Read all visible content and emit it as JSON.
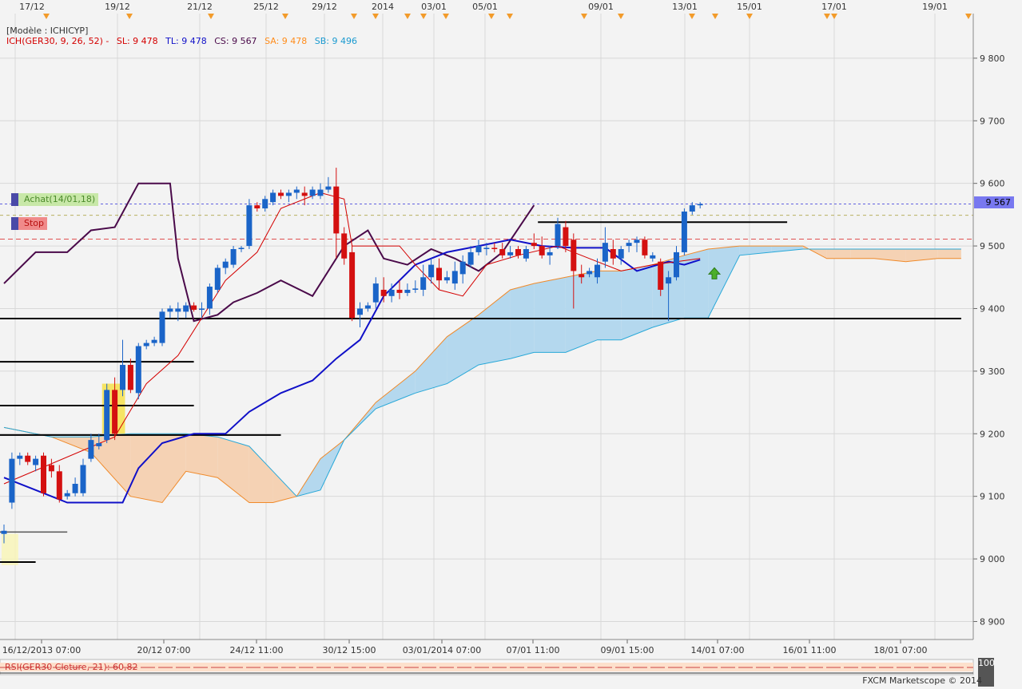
{
  "header": {
    "model": "[Modèle : ICHICYP]",
    "ich_params": "ICH(GER30, 9, 26, 52) -",
    "sl": "SL: 9 478",
    "tl": "TL: 9 478",
    "cs": "CS: 9 567",
    "sa": "SA: 9 478",
    "sb": "SB: 9 496"
  },
  "orders": {
    "buy_label": "Achat(14/01,18)",
    "stop_label": "Stop"
  },
  "price_tag": "9 567",
  "rsi_label": "RSI(GER30 Cloture, 21): 60,82",
  "rsi_scale_top": "100",
  "copyright": "FXCM Marketscope © 2014",
  "colors": {
    "bull": "#1a64c8",
    "bear": "#d41010",
    "tenkan": "#d40000",
    "kijun": "#1010c8",
    "chikou": "#4a0a4a",
    "cloud_bull": "#b4d8ee",
    "cloud_bear": "#f5d2b4",
    "grid": "#d8d8d8"
  },
  "chart_data": {
    "type": "candlestick",
    "title": "",
    "ylim": [
      8870,
      9870
    ],
    "y_ticks": [
      8900,
      9000,
      9100,
      9200,
      9300,
      9400,
      9500,
      9600,
      9700,
      9800
    ],
    "y_tick_labels": [
      "8 900",
      "9 000",
      "9 100",
      "9 200",
      "9 300",
      "9 400",
      "9 500",
      "9 600",
      "9 700",
      "9 800"
    ],
    "x_top_labels": [
      "17/12",
      "19/12",
      "21/12",
      "25/12",
      "29/12",
      "2014",
      "03/01",
      "05/01",
      "09/01",
      "13/01",
      "15/01",
      "17/01",
      "19/01"
    ],
    "x_bottom_labels": [
      "16/12/2013 07:00",
      "20/12 07:00",
      "24/12 11:00",
      "30/12 15:00",
      "03/01/2014 07:00",
      "07/01 11:00",
      "09/01 15:00",
      "14/01 07:00",
      "16/01 11:00",
      "18/01 07:00"
    ],
    "candles": [
      {
        "o": 9040,
        "h": 9055,
        "l": 9025,
        "c": 9045
      },
      {
        "o": 9090,
        "h": 9170,
        "l": 9080,
        "c": 9160
      },
      {
        "o": 9160,
        "h": 9170,
        "l": 9150,
        "c": 9165
      },
      {
        "o": 9165,
        "h": 9170,
        "l": 9150,
        "c": 9155
      },
      {
        "o": 9150,
        "h": 9165,
        "l": 9140,
        "c": 9160
      },
      {
        "o": 9165,
        "h": 9170,
        "l": 9100,
        "c": 9105
      },
      {
        "o": 9150,
        "h": 9160,
        "l": 9130,
        "c": 9140
      },
      {
        "o": 9140,
        "h": 9150,
        "l": 9090,
        "c": 9095
      },
      {
        "o": 9100,
        "h": 9110,
        "l": 9095,
        "c": 9105
      },
      {
        "o": 9105,
        "h": 9130,
        "l": 9100,
        "c": 9120
      },
      {
        "o": 9105,
        "h": 9160,
        "l": 9100,
        "c": 9150
      },
      {
        "o": 9160,
        "h": 9200,
        "l": 9155,
        "c": 9190
      },
      {
        "o": 9180,
        "h": 9200,
        "l": 9175,
        "c": 9185
      },
      {
        "o": 9190,
        "h": 9280,
        "l": 9185,
        "c": 9270
      },
      {
        "o": 9270,
        "h": 9290,
        "l": 9190,
        "c": 9200
      },
      {
        "o": 9270,
        "h": 9350,
        "l": 9260,
        "c": 9310
      },
      {
        "o": 9310,
        "h": 9320,
        "l": 9265,
        "c": 9270
      },
      {
        "o": 9265,
        "h": 9345,
        "l": 9255,
        "c": 9340
      },
      {
        "o": 9340,
        "h": 9350,
        "l": 9335,
        "c": 9345
      },
      {
        "o": 9345,
        "h": 9355,
        "l": 9340,
        "c": 9350
      },
      {
        "o": 9345,
        "h": 9400,
        "l": 9340,
        "c": 9395
      },
      {
        "o": 9395,
        "h": 9405,
        "l": 9385,
        "c": 9400
      },
      {
        "o": 9395,
        "h": 9410,
        "l": 9380,
        "c": 9400
      },
      {
        "o": 9395,
        "h": 9410,
        "l": 9385,
        "c": 9405
      },
      {
        "o": 9405,
        "h": 9410,
        "l": 9395,
        "c": 9398
      },
      {
        "o": 9398,
        "h": 9410,
        "l": 9385,
        "c": 9400
      },
      {
        "o": 9400,
        "h": 9440,
        "l": 9390,
        "c": 9435
      },
      {
        "o": 9430,
        "h": 9470,
        "l": 9425,
        "c": 9465
      },
      {
        "o": 9465,
        "h": 9480,
        "l": 9455,
        "c": 9475
      },
      {
        "o": 9470,
        "h": 9500,
        "l": 9465,
        "c": 9495
      },
      {
        "o": 9495,
        "h": 9500,
        "l": 9490,
        "c": 9497
      },
      {
        "o": 9500,
        "h": 9575,
        "l": 9495,
        "c": 9565
      },
      {
        "o": 9565,
        "h": 9570,
        "l": 9555,
        "c": 9560
      },
      {
        "o": 9560,
        "h": 9580,
        "l": 9555,
        "c": 9575
      },
      {
        "o": 9570,
        "h": 9590,
        "l": 9565,
        "c": 9585
      },
      {
        "o": 9585,
        "h": 9590,
        "l": 9575,
        "c": 9580
      },
      {
        "o": 9580,
        "h": 9590,
        "l": 9570,
        "c": 9585
      },
      {
        "o": 9585,
        "h": 9595,
        "l": 9575,
        "c": 9590
      },
      {
        "o": 9585,
        "h": 9595,
        "l": 9565,
        "c": 9580
      },
      {
        "o": 9580,
        "h": 9595,
        "l": 9575,
        "c": 9590
      },
      {
        "o": 9580,
        "h": 9600,
        "l": 9575,
        "c": 9590
      },
      {
        "o": 9590,
        "h": 9610,
        "l": 9585,
        "c": 9595
      },
      {
        "o": 9595,
        "h": 9625,
        "l": 9480,
        "c": 9520
      },
      {
        "o": 9520,
        "h": 9530,
        "l": 9470,
        "c": 9480
      },
      {
        "o": 9490,
        "h": 9500,
        "l": 9380,
        "c": 9385
      },
      {
        "o": 9390,
        "h": 9410,
        "l": 9370,
        "c": 9400
      },
      {
        "o": 9400,
        "h": 9410,
        "l": 9395,
        "c": 9405
      },
      {
        "o": 9410,
        "h": 9450,
        "l": 9400,
        "c": 9440
      },
      {
        "o": 9430,
        "h": 9450,
        "l": 9410,
        "c": 9420
      },
      {
        "o": 9420,
        "h": 9440,
        "l": 9410,
        "c": 9430
      },
      {
        "o": 9430,
        "h": 9445,
        "l": 9415,
        "c": 9425
      },
      {
        "o": 9425,
        "h": 9440,
        "l": 9420,
        "c": 9430
      },
      {
        "o": 9430,
        "h": 9445,
        "l": 9425,
        "c": 9432
      },
      {
        "o": 9430,
        "h": 9470,
        "l": 9420,
        "c": 9450
      },
      {
        "o": 9450,
        "h": 9480,
        "l": 9440,
        "c": 9470
      },
      {
        "o": 9465,
        "h": 9480,
        "l": 9430,
        "c": 9445
      },
      {
        "o": 9445,
        "h": 9460,
        "l": 9440,
        "c": 9450
      },
      {
        "o": 9440,
        "h": 9475,
        "l": 9430,
        "c": 9460
      },
      {
        "o": 9455,
        "h": 9485,
        "l": 9440,
        "c": 9475
      },
      {
        "o": 9470,
        "h": 9500,
        "l": 9465,
        "c": 9490
      },
      {
        "o": 9490,
        "h": 9510,
        "l": 9485,
        "c": 9500
      },
      {
        "o": 9495,
        "h": 9505,
        "l": 9485,
        "c": 9497
      },
      {
        "o": 9497,
        "h": 9505,
        "l": 9490,
        "c": 9495
      },
      {
        "o": 9495,
        "h": 9505,
        "l": 9480,
        "c": 9485
      },
      {
        "o": 9485,
        "h": 9500,
        "l": 9480,
        "c": 9490
      },
      {
        "o": 9495,
        "h": 9500,
        "l": 9480,
        "c": 9485
      },
      {
        "o": 9480,
        "h": 9500,
        "l": 9475,
        "c": 9495
      },
      {
        "o": 9505,
        "h": 9520,
        "l": 9495,
        "c": 9500
      },
      {
        "o": 9500,
        "h": 9515,
        "l": 9480,
        "c": 9485
      },
      {
        "o": 9485,
        "h": 9500,
        "l": 9470,
        "c": 9490
      },
      {
        "o": 9500,
        "h": 9545,
        "l": 9495,
        "c": 9535
      },
      {
        "o": 9530,
        "h": 9540,
        "l": 9490,
        "c": 9500
      },
      {
        "o": 9510,
        "h": 9520,
        "l": 9400,
        "c": 9460
      },
      {
        "o": 9455,
        "h": 9470,
        "l": 9440,
        "c": 9450
      },
      {
        "o": 9455,
        "h": 9465,
        "l": 9450,
        "c": 9460
      },
      {
        "o": 9450,
        "h": 9480,
        "l": 9440,
        "c": 9470
      },
      {
        "o": 9475,
        "h": 9530,
        "l": 9465,
        "c": 9505
      },
      {
        "o": 9495,
        "h": 9510,
        "l": 9470,
        "c": 9480
      },
      {
        "o": 9480,
        "h": 9500,
        "l": 9470,
        "c": 9495
      },
      {
        "o": 9500,
        "h": 9510,
        "l": 9490,
        "c": 9505
      },
      {
        "o": 9505,
        "h": 9515,
        "l": 9490,
        "c": 9510
      },
      {
        "o": 9510,
        "h": 9515,
        "l": 9480,
        "c": 9485
      },
      {
        "o": 9480,
        "h": 9490,
        "l": 9475,
        "c": 9485
      },
      {
        "o": 9475,
        "h": 9480,
        "l": 9420,
        "c": 9430
      },
      {
        "o": 9440,
        "h": 9460,
        "l": 9380,
        "c": 9450
      },
      {
        "o": 9450,
        "h": 9500,
        "l": 9445,
        "c": 9490
      },
      {
        "o": 9490,
        "h": 9560,
        "l": 9485,
        "c": 9555
      },
      {
        "o": 9555,
        "h": 9570,
        "l": 9550,
        "c": 9565
      },
      {
        "o": 9565,
        "h": 9570,
        "l": 9560,
        "c": 9567
      }
    ],
    "tenkan": [
      [
        0,
        9120
      ],
      [
        14,
        9195
      ],
      [
        18,
        9280
      ],
      [
        22,
        9325
      ],
      [
        25,
        9385
      ],
      [
        28,
        9445
      ],
      [
        32,
        9490
      ],
      [
        35,
        9560
      ],
      [
        40,
        9585
      ],
      [
        43,
        9575
      ],
      [
        44,
        9500
      ],
      [
        47,
        9500
      ],
      [
        50,
        9500
      ],
      [
        52,
        9470
      ],
      [
        55,
        9430
      ],
      [
        58,
        9420
      ],
      [
        61,
        9470
      ],
      [
        65,
        9485
      ],
      [
        70,
        9500
      ],
      [
        74,
        9480
      ],
      [
        78,
        9460
      ],
      [
        82,
        9470
      ],
      [
        85,
        9475
      ],
      [
        88,
        9480
      ]
    ],
    "kijun": [
      [
        0,
        9130
      ],
      [
        4,
        9110
      ],
      [
        8,
        9090
      ],
      [
        15,
        9090
      ],
      [
        17,
        9145
      ],
      [
        20,
        9185
      ],
      [
        24,
        9200
      ],
      [
        28,
        9200
      ],
      [
        31,
        9235
      ],
      [
        35,
        9265
      ],
      [
        39,
        9285
      ],
      [
        42,
        9320
      ],
      [
        45,
        9350
      ],
      [
        48,
        9420
      ],
      [
        52,
        9470
      ],
      [
        56,
        9490
      ],
      [
        60,
        9500
      ],
      [
        64,
        9510
      ],
      [
        68,
        9500
      ],
      [
        72,
        9497
      ],
      [
        76,
        9497
      ],
      [
        80,
        9460
      ],
      [
        84,
        9475
      ],
      [
        86,
        9470
      ],
      [
        88,
        9478
      ]
    ],
    "chikou": [
      [
        0,
        9440
      ],
      [
        4,
        9490
      ],
      [
        8,
        9490
      ],
      [
        11,
        9525
      ],
      [
        14,
        9530
      ],
      [
        17,
        9600
      ],
      [
        21,
        9600
      ],
      [
        22,
        9480
      ],
      [
        24,
        9380
      ],
      [
        27,
        9390
      ],
      [
        29,
        9410
      ],
      [
        32,
        9425
      ],
      [
        35,
        9445
      ],
      [
        39,
        9420
      ],
      [
        43,
        9500
      ],
      [
        46,
        9525
      ],
      [
        48,
        9480
      ],
      [
        51,
        9470
      ],
      [
        54,
        9495
      ],
      [
        57,
        9480
      ],
      [
        60,
        9460
      ],
      [
        63,
        9490
      ],
      [
        67,
        9565
      ]
    ],
    "span_a": [
      [
        0,
        9210
      ],
      [
        6,
        9195
      ],
      [
        11,
        9170
      ],
      [
        16,
        9100
      ],
      [
        20,
        9090
      ],
      [
        23,
        9140
      ],
      [
        27,
        9130
      ],
      [
        31,
        9090
      ],
      [
        34,
        9090
      ],
      [
        37,
        9100
      ],
      [
        40,
        9160
      ],
      [
        43,
        9190
      ],
      [
        47,
        9250
      ],
      [
        52,
        9300
      ],
      [
        56,
        9355
      ],
      [
        60,
        9390
      ],
      [
        64,
        9430
      ],
      [
        67,
        9440
      ],
      [
        71,
        9450
      ],
      [
        75,
        9460
      ],
      [
        78,
        9460
      ],
      [
        82,
        9470
      ],
      [
        86,
        9485
      ],
      [
        89,
        9495
      ],
      [
        93,
        9500
      ],
      [
        97,
        9500
      ],
      [
        101,
        9500
      ],
      [
        104,
        9480
      ],
      [
        107,
        9480
      ],
      [
        110,
        9480
      ],
      [
        114,
        9475
      ],
      [
        118,
        9480
      ],
      [
        121,
        9480
      ]
    ],
    "span_b": [
      [
        0,
        9210
      ],
      [
        6,
        9195
      ],
      [
        11,
        9195
      ],
      [
        16,
        9200
      ],
      [
        20,
        9200
      ],
      [
        23,
        9200
      ],
      [
        27,
        9195
      ],
      [
        31,
        9180
      ],
      [
        34,
        9140
      ],
      [
        37,
        9100
      ],
      [
        40,
        9110
      ],
      [
        43,
        9190
      ],
      [
        47,
        9240
      ],
      [
        52,
        9265
      ],
      [
        56,
        9280
      ],
      [
        60,
        9310
      ],
      [
        64,
        9320
      ],
      [
        67,
        9330
      ],
      [
        71,
        9330
      ],
      [
        75,
        9350
      ],
      [
        78,
        9350
      ],
      [
        82,
        9370
      ],
      [
        86,
        9385
      ],
      [
        89,
        9385
      ],
      [
        93,
        9485
      ],
      [
        97,
        9490
      ],
      [
        101,
        9495
      ],
      [
        104,
        9495
      ],
      [
        107,
        9495
      ],
      [
        110,
        9495
      ],
      [
        114,
        9495
      ],
      [
        118,
        9495
      ],
      [
        121,
        9495
      ]
    ],
    "hlines": [
      {
        "y": 9384,
        "from": 0,
        "to": 121,
        "width": 2,
        "color": "#000"
      },
      {
        "y": 9315,
        "from": 0,
        "to": 24,
        "width": 2,
        "color": "#000"
      },
      {
        "y": 9245,
        "from": 0,
        "to": 24,
        "width": 2,
        "color": "#000"
      },
      {
        "y": 9198,
        "from": 0,
        "to": 35,
        "width": 2,
        "color": "#000"
      },
      {
        "y": 9538,
        "from": 68,
        "to": 99,
        "width": 2,
        "color": "#000"
      },
      {
        "y": 9043,
        "from": 0,
        "to": 8,
        "width": 1.5,
        "color": "#555"
      },
      {
        "y": 8995,
        "from": 0,
        "to": 4,
        "width": 2,
        "color": "#000"
      }
    ],
    "level_lines": [
      {
        "y": 9567,
        "color": "#6060e0",
        "dash": "3,3"
      },
      {
        "y": 9549,
        "color": "#b8b060",
        "dash": "4,4"
      },
      {
        "y": 9511,
        "color": "#e05050",
        "dash": "6,4"
      }
    ],
    "highlights": [
      {
        "from": 12.4,
        "to": 15.3,
        "y0": 9200,
        "y1": 9280,
        "color": "#f6e04a"
      },
      {
        "from": -0.3,
        "to": 1.8,
        "y0": 8990,
        "y1": 9040,
        "color": "#f8f4b8"
      }
    ],
    "arrow": {
      "index": 89.8,
      "y": 9455
    }
  }
}
